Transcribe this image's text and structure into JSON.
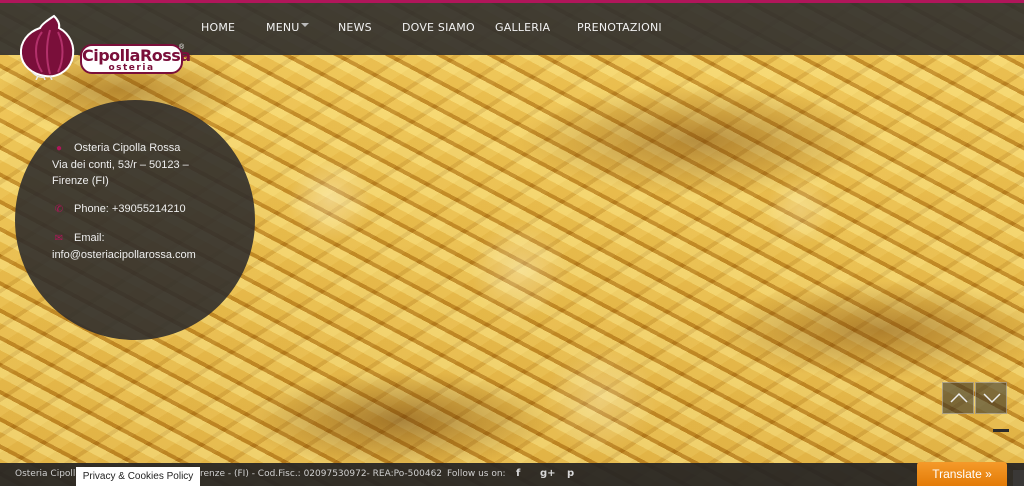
{
  "brand": {
    "name": "CipollaRossa",
    "sub": "osteria",
    "reg": "®",
    "colors": {
      "accent": "#b0165a",
      "dark": "#34322e",
      "translate": "#e37b07"
    }
  },
  "nav": {
    "items": [
      {
        "label": "HOME"
      },
      {
        "label": "MENU"
      },
      {
        "label": "NEWS"
      },
      {
        "label": "DOVE SIAMO"
      },
      {
        "label": "GALLERIA"
      },
      {
        "label": "PRENOTAZIONI"
      }
    ]
  },
  "contact": {
    "name": "Osteria Cipolla Rossa",
    "address_line1": "Via dei conti, 53/r – 50123 –",
    "address_line2": "Firenze (FI)",
    "phone": "Phone: +39055214210",
    "email_label": "Email:",
    "email": "info@osteriacipollarossa.com",
    "icons": [
      "map-marker-icon",
      "phone-icon",
      "envelope-icon"
    ]
  },
  "slider": {
    "prev_icon": "chevron-up-icon",
    "next_icon": "chevron-down-icon"
  },
  "footer": {
    "text_start": "Osteria Cipolla",
    "text_end": "renze - (FI) - Cod.Fisc.: 02097530972- REA:Po-500462",
    "follow_label": "Follow us on:",
    "social": [
      {
        "icon": "facebook-icon",
        "glyph": "f"
      },
      {
        "icon": "google-plus-icon",
        "glyph": "g+"
      },
      {
        "icon": "pinterest-icon",
        "glyph": "p"
      }
    ]
  },
  "privacy": {
    "label": "Privacy & Cookies Policy"
  },
  "translate": {
    "label": "Translate »"
  }
}
